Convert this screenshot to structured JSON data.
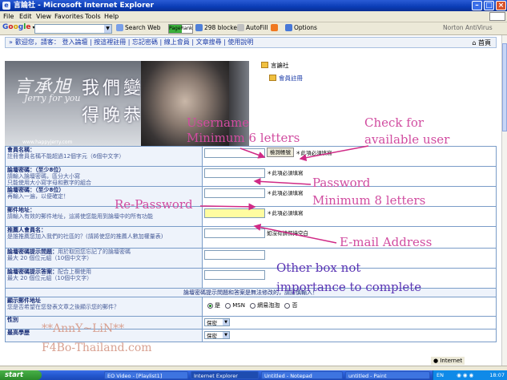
{
  "window": {
    "title": "言論社 - Microsoft Internet Explorer"
  },
  "menu": [
    "File",
    "Edit",
    "View",
    "Favorites",
    "Tools",
    "Help"
  ],
  "toolbar": {
    "google": "Google",
    "search_web": "Search Web",
    "pagerank": "PageRank",
    "blocked": "298 blocked",
    "autofill": "AutoFill",
    "options": "Options",
    "norton": "Norton AntiVirus"
  },
  "nav": {
    "welcome": "歡迎您，請客：",
    "links": [
      "登入論壇",
      "按這裡註冊",
      "忘記密碼",
      "線上會員",
      "文章搜尋",
      "使用說明"
    ],
    "home": "首頁"
  },
  "banner": {
    "signature": "言承旭",
    "sub": "Jerry for you",
    "title": "我們變得晚恭",
    "url": "www.happyjerry.com"
  },
  "sidenav": {
    "root": "言論社",
    "child": "會員註冊"
  },
  "form": {
    "rows": [
      {
        "label": "會員名稱：",
        "desc": "註冊會員名稱不能超過12個字元（6個中文字）",
        "button": "檢測帳號",
        "hint": "＊此項必須填寫"
      },
      {
        "label": "論壇密碼：（至少8位）",
        "desc": "請輸入論壇密碼，區分大小寫",
        "desc2": "只能使用大小寫字母和數字的組合",
        "hint": "＊此項必須填寫"
      },
      {
        "label": "論壇密碼：（至少8位）",
        "desc": "再輸入一遍，以便確定！",
        "hint": "＊此項必須填寫"
      },
      {
        "label": "郵件地址：",
        "desc": "請輸入有效的郵件地址，這將使您能用到論壇中的所有功能",
        "hint": "＊此項必須填寫"
      },
      {
        "label": "推薦人會員名：",
        "desc": "是誰推薦您加入我們的社區的？(請將使您的推薦人數加權量表)",
        "hint": "如沒有請保持空白"
      },
      {
        "label": "論壇密碼提示問題：",
        "desc": "用於取回您忘記了的論壇密碼",
        "desc2": "最大 20 個位元組（10個中文字）"
      },
      {
        "label": "論壇密碼提示答案：",
        "desc": "配合上欄使用",
        "desc2": "最大 20 個位元組（10個中文字）"
      }
    ],
    "notice": "論壇密碼提示問題和答案是無法修改的，請謹慎輸入！",
    "email_show": {
      "label": "顯示郵件地址",
      "desc": "您是否希望在您發表文章之後顯示您的郵件？",
      "options": [
        "是",
        "MSN",
        "網易泡泡",
        "否"
      ]
    },
    "gender": {
      "label": "性別",
      "value": "保密"
    },
    "education": {
      "label": "最高學歷",
      "value": "保密"
    }
  },
  "annotations": {
    "username": "Username",
    "username_min": "Minimum 6 letters",
    "check": "Check for",
    "check2": "available user",
    "password": "Password",
    "password_min": "Minimum 8 letters",
    "repassword": "Re-Password",
    "email": "E-mail Address",
    "other1": "Other box not",
    "other2": "importance to complete",
    "watermark1": "**AnnY~LiN**",
    "watermark2": "F4Bo-Thailand.com"
  },
  "status": {
    "zone": "Internet"
  },
  "taskbar": {
    "start": "start",
    "buttons": [
      "EO Video - [Playlist1]",
      "Internet Explorer",
      "Untitled - Notepad",
      "untitled - Paint"
    ],
    "lang": "EN",
    "clock": "18:07"
  }
}
